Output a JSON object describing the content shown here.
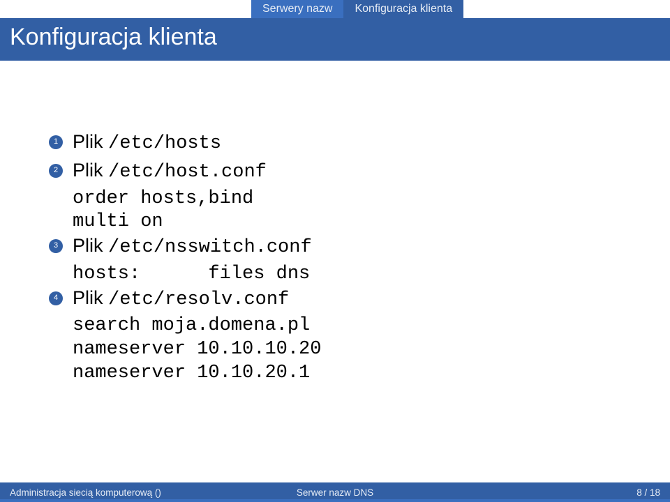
{
  "tabs": [
    "Serwery nazw",
    "Konfiguracja klienta"
  ],
  "title": "Konfiguracja klienta",
  "items": [
    {
      "n": "1",
      "label": "Plik ",
      "path": "/etc/hosts",
      "code": []
    },
    {
      "n": "2",
      "label": "Plik ",
      "path": "/etc/host.conf",
      "code": [
        "order hosts,bind",
        "multi on"
      ]
    },
    {
      "n": "3",
      "label": "Plik ",
      "path": "/etc/nsswitch.conf",
      "code": [
        "hosts:      files dns"
      ]
    },
    {
      "n": "4",
      "label": "Plik ",
      "path": "/etc/resolv.conf",
      "code": [
        "search moja.domena.pl",
        "nameserver 10.10.10.20",
        "nameserver 10.10.20.1"
      ]
    }
  ],
  "footer": {
    "left": "Administracja siecią komputerową ()",
    "center": "Serwer nazw DNS",
    "right": "8 / 18"
  }
}
